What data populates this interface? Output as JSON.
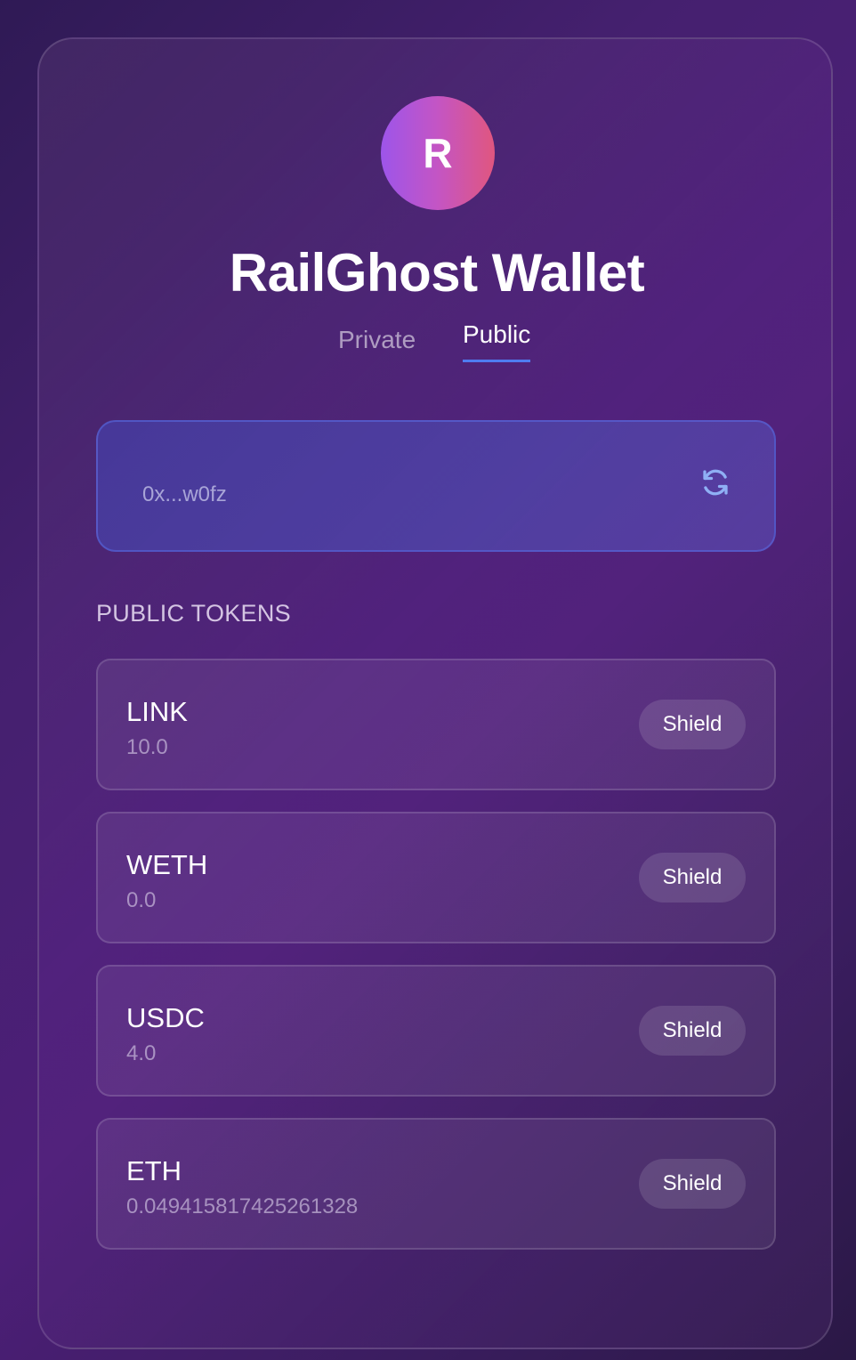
{
  "wallet": {
    "avatar_letter": "R",
    "title": "RailGhost Wallet"
  },
  "tabs": {
    "private_label": "Private",
    "public_label": "Public",
    "active": "Public"
  },
  "address": {
    "display": "0x...w0fz",
    "action_icon": "refresh-icon"
  },
  "tokens_section": {
    "heading": "PUBLIC TOKENS",
    "items": [
      {
        "symbol": "LINK",
        "balance": "10.0",
        "action_label": "Shield"
      },
      {
        "symbol": "WETH",
        "balance": "0.0",
        "action_label": "Shield"
      },
      {
        "symbol": "USDC",
        "balance": "4.0",
        "action_label": "Shield"
      },
      {
        "symbol": "ETH",
        "balance": "0.049415817425261328",
        "action_label": "Shield"
      }
    ]
  },
  "colors": {
    "accent": "#4f7cf0",
    "avatar_gradient_start": "#9d55ea",
    "avatar_gradient_end": "#e0567f",
    "refresh_icon": "#8fb0f5"
  }
}
